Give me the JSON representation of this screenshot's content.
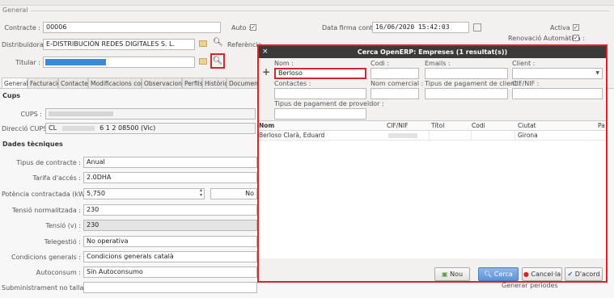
{
  "form": {
    "section_general": "General",
    "contracte_label": "Contracte :",
    "contracte_value": "00006",
    "auto_label": "Auto :",
    "distribuidora_label": "Distribuïdora :",
    "distribuidora_value": "E-DISTRIBUCIÓN REDES DIGITALES S. L.",
    "referencia_label": "Referència",
    "titular_label": "Titular :",
    "data_firma_label": "Data firma contracte :",
    "data_firma_value": "16/06/2020 15:42:03",
    "activa_label": "Activa :",
    "renovacio_label": "Renovació Automàtica :",
    "tabs": [
      "General",
      "Facturació",
      "Contactes",
      "Modificacions contr.",
      "Observacions",
      "Perfils",
      "Històric",
      "Documents"
    ],
    "section_cups": "Cups",
    "cups_label": "CUPS :",
    "direccio_label": "Direcció CUPS :",
    "direccio_prefix": "CL",
    "direccio_value": "6 1 2 08500 (Vic)",
    "section_dades": "Dades tècniques",
    "tipus_contracte_label": "Tipus de contracte :",
    "tipus_contracte_value": "Anual",
    "tarifa_label": "Tarifa d'accés :",
    "tarifa_value": "2.0DHA",
    "potencia_label": "Potència contractada (kW) :",
    "potencia_value": "5,750",
    "potencia_no": "No",
    "tensio_norm_label": "Tensió normalitzada :",
    "tensio_norm_value": "230",
    "tensio_label": "Tensió (v) :",
    "tensio_value": "230",
    "telegestio_label": "Telegestió :",
    "telegestio_value": "No operativa",
    "condicions_label": "Condicions generals :",
    "condicions_value": "Condicions generals català",
    "autoconsum_label": "Autoconsum :",
    "autoconsum_value": "Sin Autoconsumo",
    "subministrament_label": "Subministrament no tallable :",
    "generar_periodes": "Generar periodes"
  },
  "dialog": {
    "title": "Cerca OpenERP: Empreses (1 resultat(s))",
    "nom_label": "Nom :",
    "nom_value": "Berloso",
    "codi_label": "Codi :",
    "emails_label": "Emails :",
    "client_label": "Client :",
    "contactes_label": "Contactes :",
    "nom_comercial_label": "Nom comercial :",
    "tipus_pagament_client_label": "Tipus de pagament de client :",
    "cif_nif_label": "CIF/NIF :",
    "tipus_pagament_proveidor_label": "Tipus de pagament de proveïdor :",
    "columns": [
      "Nom",
      "CIF/NIF",
      "Títol",
      "Codi",
      "Ciutat",
      "Pa"
    ],
    "rows": [
      {
        "nom": "Berloso Clarà, Eduard",
        "cif": "",
        "titol": "",
        "codi": "",
        "ciutat": "Girona"
      }
    ],
    "btn_nou": "Nou",
    "btn_cerca": "Cerca",
    "btn_cancel": "Cancel·la",
    "btn_dacord": "D'acord"
  },
  "colors": {
    "highlight": "#d9232d",
    "dialog_title_bg": "#3a3a3a",
    "primary": "#5e93d8"
  }
}
